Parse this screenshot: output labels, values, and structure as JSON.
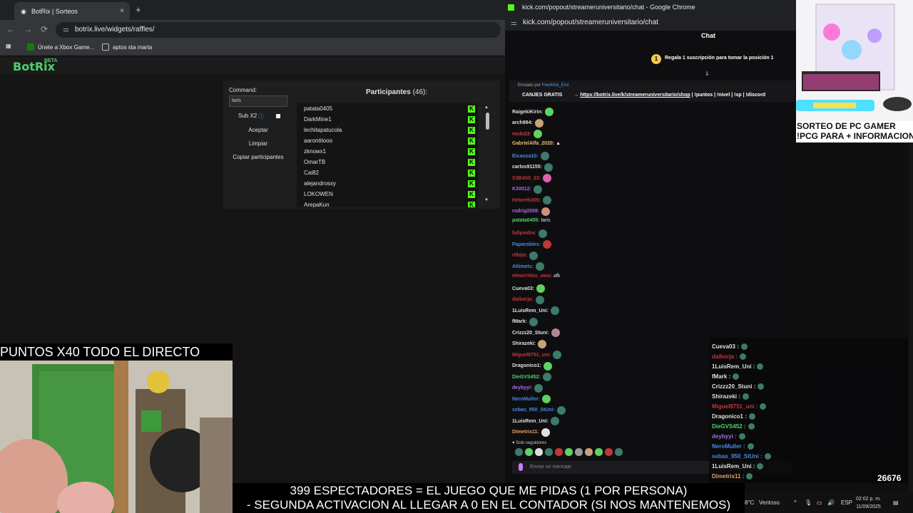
{
  "left_browser": {
    "tab_title": "BotRix | Sorteos",
    "tab_close": "×",
    "new_tab": "+",
    "url": "botrix.live/widgets/raffles/",
    "bookmarks": [
      "Únete a Xbox Game...",
      "aptos sta marta"
    ],
    "nav": {
      "back": "←",
      "forward": "→",
      "reload": "⟳",
      "apps": "▦"
    }
  },
  "botrix": {
    "logo": "BotRix",
    "beta": "BETA",
    "command_label": "Command:",
    "command_value": "laris",
    "sub_label": "Sub X2",
    "accept": "Aceptar",
    "clear": "Limpiar",
    "copy": "Copiar participantes",
    "participants_title": "Participantes",
    "participants_count": "(46):",
    "participants": [
      "patata0405",
      "DarkMine1",
      "lechitapatucola",
      "aarontitooo",
      "zknowx1",
      "OmarTB",
      "Cai82",
      "alejandrosxy",
      "LOKOWEN",
      "ArepaKun"
    ]
  },
  "stream_overlay": {
    "banner": "PUNTOS X40 TODO EL DIRECTO",
    "ticker_line1": "399 ESPECTADORES = EL JUEGO QUE ME PIDAS (1 POR PERSONA)",
    "ticker_line2": "- SEGUNDA ACTIVACION AL LLEGAR A 0 EN EL CONTADOR (SI NOS MANTENEMOS)",
    "ad_line1": "SORTEO DE PC GAMER",
    "ad_line2": "!PCG PARA + INFORMACION",
    "counter": "26676"
  },
  "chat_window": {
    "title": "kick.com/popout/streameruniversitario/chat - Google Chrome",
    "url": "kick.com/popout/streameruniversitario/chat",
    "header": "Chat",
    "gift_number": "1",
    "gift_text": "Regala 1 suscripción para tomar la posición 1",
    "pinned_by": "Enviado por",
    "pinned_user": "FrenKick_Emi",
    "pinned_title": "CANJES GRATIS",
    "pinned_arrow": "→",
    "pinned_link": "https://botrix.live/k/streameruniversitario/shop",
    "pinned_rest": "| !puntos | !nivel | !xp | !discord",
    "followers_only": "♥ Solo seguidores",
    "send_placeholder": "Enviar un mensaje",
    "messages": [
      {
        "user": "RaigekiKirin:",
        "color": "#e0e0e0",
        "text": "",
        "emote": "#5fd35f"
      },
      {
        "user": "arch994:",
        "color": "#e0e0e0",
        "text": "",
        "emote": "#c9a27c"
      },
      {
        "user": "rocki23:",
        "color": "#d04040",
        "text": "",
        "emote": "#5fd35f"
      },
      {
        "user": "GabrielAlfa_2020:",
        "color": "#e8c070",
        "text": "▲",
        "emote": ""
      },
      {
        "user": "Eicausa10:",
        "color": "#4a88e0",
        "text": "",
        "emote": "#3d7a6a"
      },
      {
        "user": "carlos91155:",
        "color": "#e0e0e0",
        "text": "",
        "emote": "#3d7a6a"
      },
      {
        "user": "S3B4S0_23:",
        "color": "#c03838",
        "text": "",
        "emote": "#e060b0"
      },
      {
        "user": "K30012:",
        "color": "#a070e0",
        "text": "",
        "emote": "#3d7a6a"
      },
      {
        "user": "Hebertk305:",
        "color": "#c03838",
        "text": "",
        "emote": "#3d7a6a"
      },
      {
        "user": "rodrig2008:",
        "color": "#a070e0",
        "text": "",
        "emote": "#d09080"
      },
      {
        "user": "patata0405:",
        "color": "#4dd16b",
        "text": "laris",
        "emote": ""
      },
      {
        "user": "fullpiedra:",
        "color": "#c03838",
        "text": "",
        "emote": "#3d7a6a"
      },
      {
        "user": "Paparobles:",
        "color": "#4a88e0",
        "text": "",
        "emote": "#c03838"
      },
      {
        "user": "r0bijo:",
        "color": "#c03838",
        "text": "",
        "emote": "#3d7a6a"
      },
      {
        "user": "Altimets:",
        "color": "#4a88e0",
        "text": "",
        "emote": "#3d7a6a"
      },
      {
        "user": "elmorriitas_uwu:",
        "color": "#c03838",
        "text": "afk",
        "emote": ""
      },
      {
        "user": "Cueva03:",
        "color": "#e0e0e0",
        "text": "",
        "emote": "#5fd35f"
      },
      {
        "user": "daiborja:",
        "color": "#c03838",
        "text": "",
        "emote": "#3d7a6a"
      },
      {
        "user": "1LuisRem_Uni:",
        "color": "#e0e0e0",
        "text": "",
        "emote": "#3d7a6a"
      },
      {
        "user": "fMark:",
        "color": "#e0e0e0",
        "text": "",
        "emote": "#3d7a6a"
      },
      {
        "user": "Crizzz20_Stuni:",
        "color": "#e0e0e0",
        "text": "",
        "emote": "#b08890"
      },
      {
        "user": "Shirazeki:",
        "color": "#e0e0e0",
        "text": "",
        "emote": "#c9a27c"
      },
      {
        "user": "Miguel8751_uni:",
        "color": "#c03838",
        "text": "",
        "emote": "#3d7a6a"
      },
      {
        "user": "Dragonico1:",
        "color": "#e0e0e0",
        "text": "",
        "emote": "#5fd35f"
      },
      {
        "user": "DieGVS452:",
        "color": "#4dd16b",
        "text": "",
        "emote": "#3d7a6a"
      },
      {
        "user": "deybyyi:",
        "color": "#a070e0",
        "text": "",
        "emote": "#3d7a6a"
      },
      {
        "user": "NeroMuller:",
        "color": "#4a88e0",
        "text": "",
        "emote": "#5fd35f"
      },
      {
        "user": "sebas_950_StUni:",
        "color": "#4a88e0",
        "text": "",
        "emote": "#3d7a6a"
      },
      {
        "user": "1LuisRem_Uni:",
        "color": "#e0e0e0",
        "text": "",
        "emote": "#3d7a6a"
      },
      {
        "user": "Dimetrix11:",
        "color": "#e8a060",
        "text": "",
        "emote": "#e0e0e0"
      }
    ],
    "overlay_messages": [
      {
        "user": "Cueva03 :",
        "color": "#e0e0e0"
      },
      {
        "user": "daiborja :",
        "color": "#c03838"
      },
      {
        "user": "1LuisRem_Uni :",
        "color": "#e0e0e0"
      },
      {
        "user": "fMark :",
        "color": "#e0e0e0"
      },
      {
        "user": "Crizzz20_Stuni :",
        "color": "#e0e0e0"
      },
      {
        "user": "Shirazeki :",
        "color": "#e0e0e0"
      },
      {
        "user": "Miguel8751_uni :",
        "color": "#c03838"
      },
      {
        "user": "Dragonico1 :",
        "color": "#e0e0e0"
      },
      {
        "user": "DieGVS452 :",
        "color": "#4dd16b"
      },
      {
        "user": "deybyyi :",
        "color": "#a070e0"
      },
      {
        "user": "NeroMuller :",
        "color": "#4a88e0"
      },
      {
        "user": "sebas_950_StUni :",
        "color": "#4a88e0"
      },
      {
        "user": "1LuisRem_Uni :",
        "color": "#e0e0e0"
      },
      {
        "user": "Dimetrix11 :",
        "color": "#e8a060"
      }
    ]
  },
  "taskbar": {
    "weather": "8°C",
    "weather_desc": "Ventoso",
    "lang": "ESP",
    "time": "02:02 p. m.",
    "date": "11/09/2025"
  },
  "colors": {
    "kick_green": "#53fc18",
    "botrix_green": "#4dd16b",
    "chat_bg": "#0e0e10"
  }
}
